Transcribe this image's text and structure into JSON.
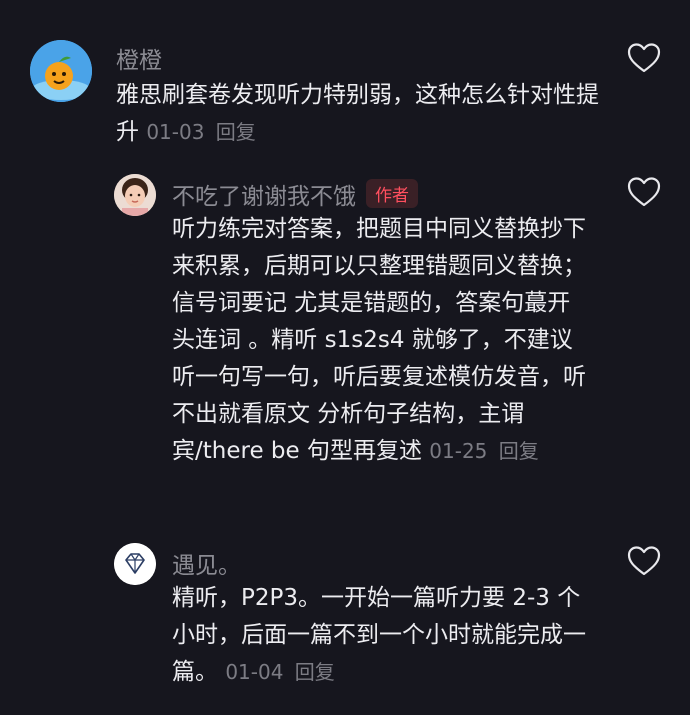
{
  "comments": [
    {
      "username": "橙橙",
      "text": "雅思刷套卷发现听力特别弱，这种怎么针对性提升",
      "date": "01-03",
      "reply_label": "回复"
    },
    {
      "username": "不吃了谢谢我不饿",
      "badge": "作者",
      "text": "听力练完对答案，把题目中同义替换抄下来积累，后期可以只整理错题同义替换；信号词要记 尤其是错题的，答案句蕞开头连词 。精听 s1s2s4 就够了，不建议听一句写一句，听后要复述模仿发音，听不出就看原文 分析句子结构，主谓宾/there be 句型再复述",
      "date": "01-25",
      "reply_label": "回复"
    },
    {
      "username": "遇见。",
      "text": "精听，P2P3。一开始一篇听力要 2-3 个小时，后面一篇不到一个小时就能完成一篇。",
      "date": "01-04",
      "reply_label": "回复"
    }
  ],
  "icons": {
    "like": "heart-outline-icon",
    "avatar1": "orange-fruit-avatar",
    "avatar2": "child-photo-avatar",
    "avatar3": "diamond-avatar"
  },
  "colors": {
    "background": "#16161e",
    "text": "#ececf0",
    "muted": "#8b8b93",
    "author_badge": "#ff4f5f"
  }
}
